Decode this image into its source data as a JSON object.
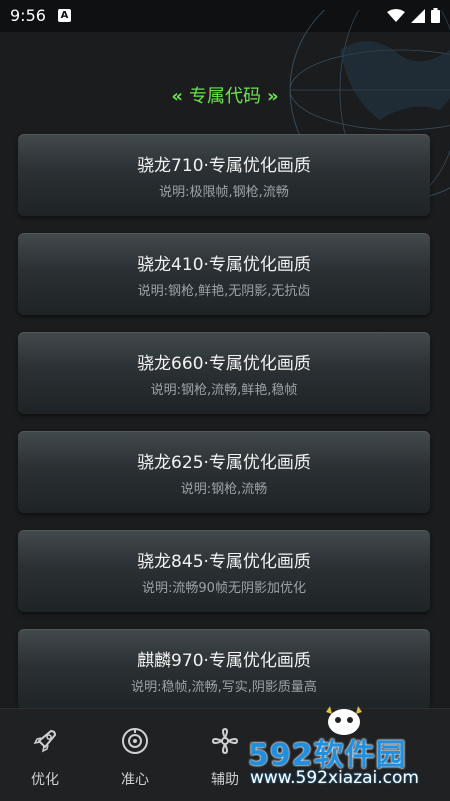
{
  "status_bar": {
    "time": "9:56",
    "app_badge": "A"
  },
  "section_title": "专属代码",
  "cards": [
    {
      "title": "骁龙710·专属优化画质",
      "desc": "说明:极限帧,钢枪,流畅"
    },
    {
      "title": "骁龙410·专属优化画质",
      "desc": "说明:钢枪,鲜艳,无阴影,无抗齿"
    },
    {
      "title": "骁龙660·专属优化画质",
      "desc": "说明:钢枪,流畅,鲜艳,稳帧"
    },
    {
      "title": "骁龙625·专属优化画质",
      "desc": "说明:钢枪,流畅"
    },
    {
      "title": "骁龙845·专属优化画质",
      "desc": "说明:流畅90帧无阴影加优化"
    },
    {
      "title": "麒麟970·专属优化画质",
      "desc": "说明:稳帧,流畅,写实,阴影质量高"
    }
  ],
  "nav": [
    {
      "label": "优化",
      "icon": "rocket-icon"
    },
    {
      "label": "准心",
      "icon": "crosshair-icon"
    },
    {
      "label": "辅助",
      "icon": "fan-icon"
    }
  ],
  "watermark": {
    "brand": "592软件园",
    "url": "www.592xiazai.com"
  }
}
